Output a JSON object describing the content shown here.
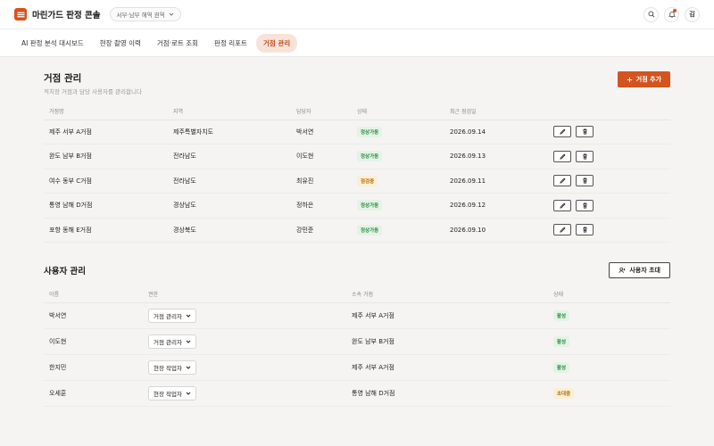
{
  "app": {
    "title": "마린가드 판정 콘솔",
    "region": "서부·남부 해역 권역",
    "avatar": "김"
  },
  "nav": {
    "tabs": [
      "AI 판정 분석 대시보드",
      "현장 촬영 이력",
      "거점·로트 조회",
      "판정 리포트",
      "거점 관리"
    ],
    "active_index": 4
  },
  "sites": {
    "title": "거점 관리",
    "subtitle": "적치장 거점과 담당 사용자를 관리합니다",
    "add_button": "거점 추가",
    "columns": [
      "거점명",
      "지역",
      "담당자",
      "상태",
      "최근 점검일"
    ],
    "rows": [
      {
        "name": "제주 서부 A거점",
        "region": "제주특별자치도",
        "manager": "박서연",
        "status": "정상가동",
        "status_type": "ok",
        "date": "2026.09.14"
      },
      {
        "name": "완도 남부 B거점",
        "region": "전라남도",
        "manager": "이도현",
        "status": "정상가동",
        "status_type": "ok",
        "date": "2026.09.13"
      },
      {
        "name": "여수 동부 C거점",
        "region": "전라남도",
        "manager": "최유진",
        "status": "점검중",
        "status_type": "warn",
        "date": "2026.09.11"
      },
      {
        "name": "통영 남해 D거점",
        "region": "경상남도",
        "manager": "정하은",
        "status": "정상가동",
        "status_type": "ok",
        "date": "2026.09.12"
      },
      {
        "name": "포항 동해 E거점",
        "region": "경상북도",
        "manager": "강민준",
        "status": "정상가동",
        "status_type": "ok",
        "date": "2026.09.10"
      }
    ]
  },
  "users": {
    "title": "사용자 관리",
    "invite_button": "사용자 초대",
    "columns": [
      "이름",
      "권한",
      "소속 거점",
      "상태"
    ],
    "rows": [
      {
        "name": "박서연",
        "role": "거점 관리자",
        "site": "제주 서부 A거점",
        "status": "활성",
        "status_type": "ok"
      },
      {
        "name": "이도현",
        "role": "거점 관리자",
        "site": "완도 남부 B거점",
        "status": "활성",
        "status_type": "ok"
      },
      {
        "name": "한지민",
        "role": "현장 작업자",
        "site": "제주 서부 A거점",
        "status": "활성",
        "status_type": "ok"
      },
      {
        "name": "오세훈",
        "role": "현장 작업자",
        "site": "통영 남해 D거점",
        "status": "초대중",
        "status_type": "warn"
      }
    ]
  }
}
